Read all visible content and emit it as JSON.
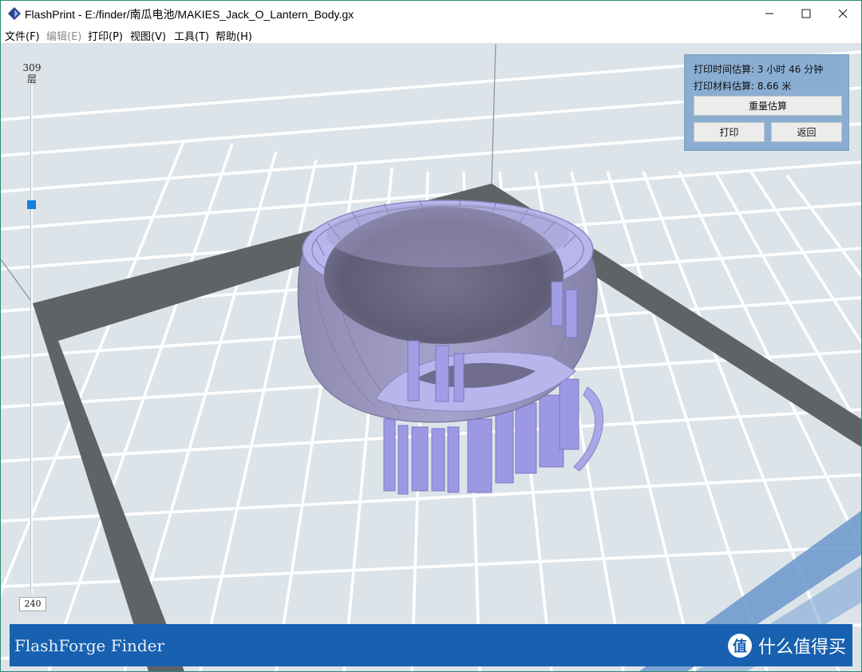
{
  "window": {
    "title": "FlashPrint - E:/finder/南瓜电池/MAKIES_Jack_O_Lantern_Body.gx"
  },
  "menu": [
    {
      "label": "文件(F)",
      "enabled": true
    },
    {
      "label": "编辑(E)",
      "enabled": false
    },
    {
      "label": "打印(P)",
      "enabled": true
    },
    {
      "label": "视图(V)",
      "enabled": true
    },
    {
      "label": "工具(T)",
      "enabled": true
    },
    {
      "label": "帮助(H)",
      "enabled": true
    }
  ],
  "layer_slider": {
    "top_value": "309",
    "top_unit": "层",
    "bottom_value": "240"
  },
  "estimate_panel": {
    "time_line": "打印时间估算: 3 小时 46 分钟",
    "material_line": "打印材料估算: 8.66 米",
    "reestimate_label": "重量估算",
    "print_label": "打印",
    "back_label": "返回"
  },
  "status_bar": {
    "printer_name": "FlashForge Finder"
  },
  "watermark": {
    "badge": "值",
    "text": "什么值得买"
  },
  "colors": {
    "model": "#a7a3e6",
    "platform": "#dfe6eb",
    "accent": "#1861b0"
  },
  "icons": [
    "app-diamond-icon",
    "minimize-icon",
    "maximize-icon",
    "close-icon"
  ]
}
